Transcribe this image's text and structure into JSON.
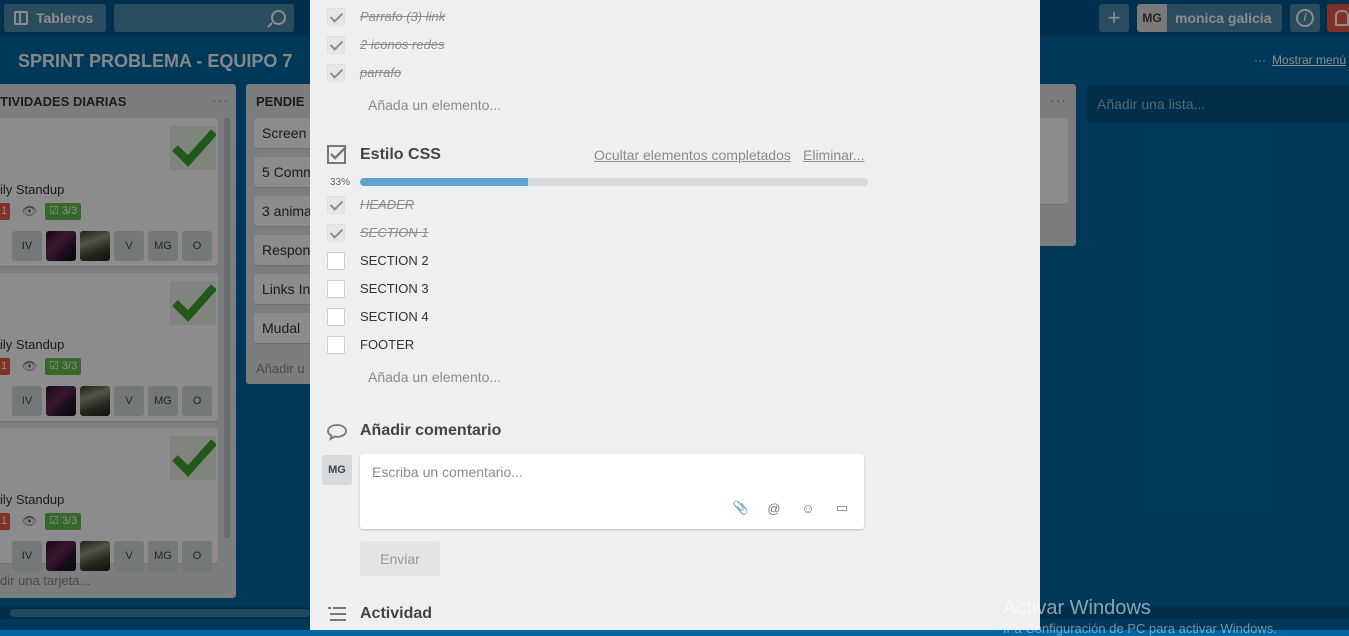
{
  "topbar": {
    "boards_label": "Tableros",
    "search_value": "",
    "user_initials": "MG",
    "user_name": "monica galicia",
    "info_glyph": "i",
    "plus_glyph": "+"
  },
  "board": {
    "title": "SPRINT PROBLEMA - EQUIPO 7",
    "menu_dots": "···",
    "menu_label": "Mostrar menú"
  },
  "lists": {
    "daily": {
      "title": "TIVIDADES DIARIAS",
      "dots": "···",
      "cards": [
        {
          "title": "ily Standup",
          "red_label": "1",
          "checklist": "3/3"
        },
        {
          "title": "ily Standup",
          "red_label": "1",
          "checklist": "3/3"
        },
        {
          "title": "ily Standup",
          "red_label": "1",
          "checklist": "3/3"
        }
      ],
      "members": [
        "IV",
        "V",
        "MG",
        "O"
      ],
      "add_card": "dir una tarjeta..."
    },
    "pending": {
      "title": "PENDIE",
      "items": [
        "Screen",
        "5 Comm",
        "3 anima",
        "Respon",
        "Links In",
        "Mudal"
      ],
      "add_card": "Añadir u"
    },
    "third": {
      "dots": "···"
    },
    "add_list": "Añadir una lista..."
  },
  "modal": {
    "checklist1_items": [
      {
        "text": "Parrafo (3) link",
        "done": true
      },
      {
        "text": "2 iconos redes",
        "done": true
      },
      {
        "text": "parrafo",
        "done": true
      }
    ],
    "add_item_1": "Añada un elemento...",
    "checklist2": {
      "title": "Estilo CSS",
      "hide_completed": "Ocultar elementos completados",
      "delete": "Eliminar...",
      "percent_label": "33%",
      "progress": 0.33,
      "items": [
        {
          "text": "HEADER",
          "done": true
        },
        {
          "text": "SECTION 1",
          "done": true
        },
        {
          "text": "SECTION 2",
          "done": false
        },
        {
          "text": "SECTION 3",
          "done": false
        },
        {
          "text": "SECTION 4",
          "done": false
        },
        {
          "text": "FOOTER",
          "done": false
        }
      ]
    },
    "add_item_2": "Añada un elemento...",
    "comment": {
      "title": "Añadir comentario",
      "avatar": "MG",
      "placeholder": "Escriba un comentario...",
      "send": "Enviar"
    },
    "activity_title": "Actividad"
  },
  "watermark": {
    "line1": "Activar Windows",
    "line2": "Ir a Configuración de PC para activar Windows."
  },
  "colors": {
    "board_bg": "#0067a3",
    "label_red": "#eb5a46",
    "label_green": "#61bd4f",
    "progress_fill": "#5ba4cf"
  }
}
